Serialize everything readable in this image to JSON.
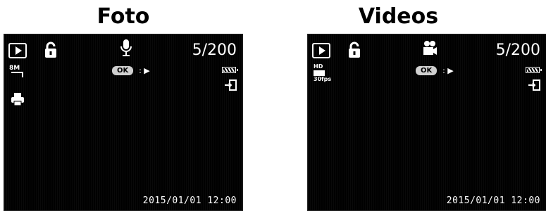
{
  "photo": {
    "title": "Foto",
    "counter": "5/200",
    "ok_label": "OK",
    "ok_arrow": ": ▶",
    "resolution": "8M",
    "timestamp": "2015/01/01 12:00"
  },
  "video": {
    "title": "Videos",
    "counter": "5/200",
    "ok_label": "OK",
    "ok_arrow": ": ▶",
    "resolution": "HD",
    "fps": "30fps",
    "timestamp": "2015/01/01 12:00"
  },
  "icons": {
    "playback": "playback-icon",
    "lock": "lock-icon",
    "microphone": "microphone-icon",
    "video_camera": "video-camera-icon",
    "print": "print-icon",
    "battery": "battery-icon",
    "transfer": "transfer-icon"
  },
  "colors": {
    "screen_bg": "#000000",
    "ok_pill": "#d0d0d0",
    "text": "#ffffff"
  }
}
